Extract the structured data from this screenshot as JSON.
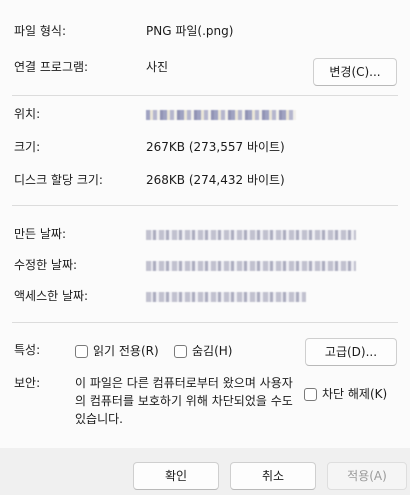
{
  "general": {
    "file_type_label": "파일 형식:",
    "file_type_value": "PNG 파일(.png)",
    "opens_with_label": "연결 프로그램:",
    "opens_with_value": "사진",
    "change_button": "변경(C)..."
  },
  "location": {
    "label": "위치:"
  },
  "size": {
    "size_label": "크기:",
    "size_value": "267KB (273,557 바이트)",
    "disk_label": "디스크 할당 크기:",
    "disk_value": "268KB (274,432 바이트)"
  },
  "dates": {
    "created_label": "만든 날짜:",
    "modified_label": "수정한 날짜:",
    "accessed_label": "액세스한 날짜:"
  },
  "attributes": {
    "label": "특성:",
    "readonly": "읽기 전용(R)",
    "hidden": "숨김(H)",
    "advanced_button": "고급(D)..."
  },
  "security": {
    "label": "보안:",
    "note": "이 파일은 다른 컴퓨터로부터 왔으며 사용자의 컴퓨터를 보호하기 위해 차단되었을 수도 있습니다.",
    "unblock": "차단 해제(K)"
  },
  "footer": {
    "ok": "확인",
    "cancel": "취소",
    "apply": "적용(A)"
  }
}
